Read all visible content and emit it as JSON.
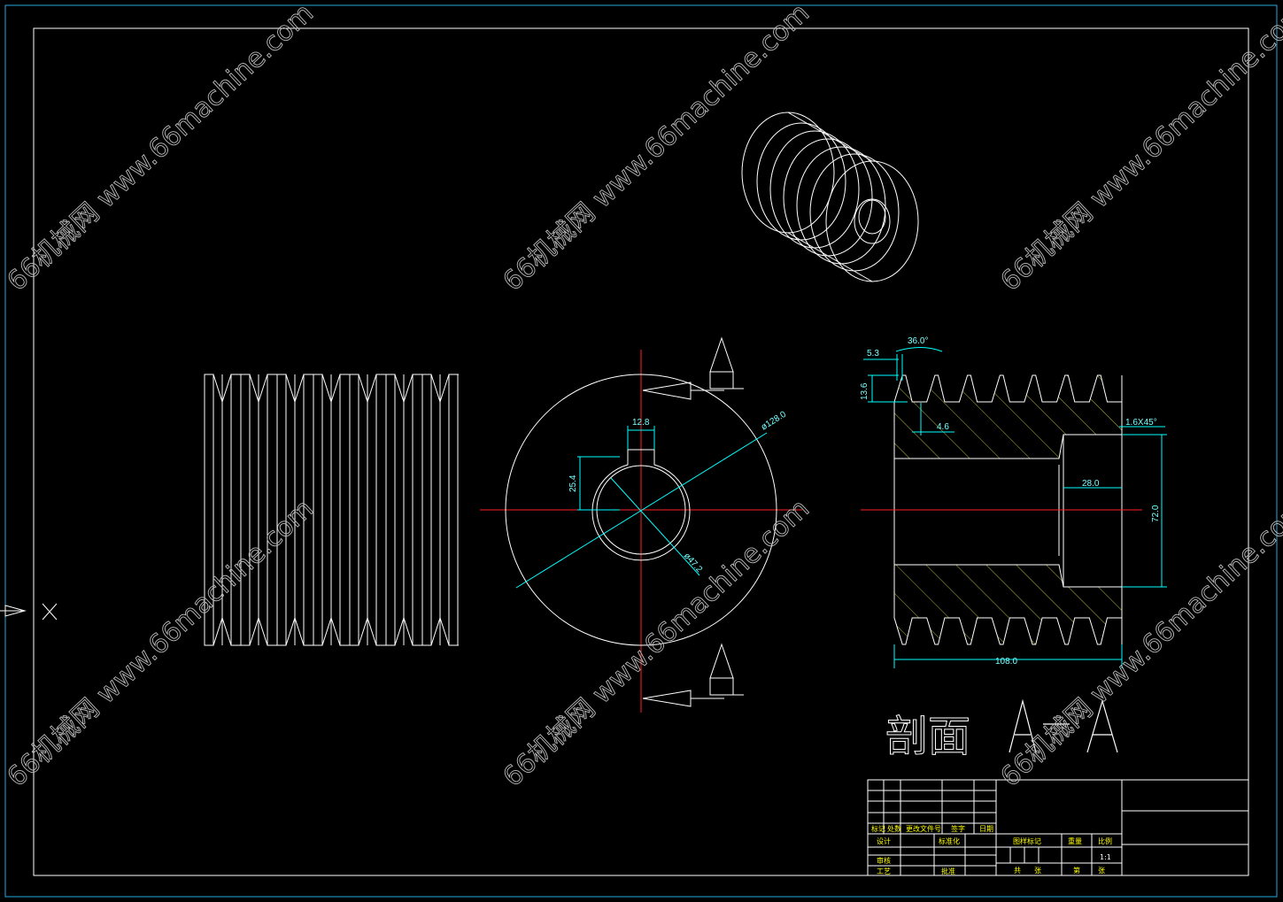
{
  "drawing": {
    "section_title": "剖面 A-A",
    "section_letter_a": "A",
    "section_letter_b": "A"
  },
  "dimensions": {
    "key_width": "12.8",
    "key_depth": "25.4",
    "outer_dia": "ø128.0",
    "bore_dia": "ø47.2",
    "thread_pitch": "5.3",
    "thread_angle": "36.0°",
    "thread_depth": "13.6",
    "root_width": "4.6",
    "chamfer": "1.6X45°",
    "counterbore_depth": "28.0",
    "counterbore_dia": "72.0",
    "overall_length": "108.0"
  },
  "title_block": {
    "row_labels": [
      "标记",
      "处数",
      "更改文件号",
      "签字",
      "日期"
    ],
    "design": "设计",
    "standard": "标准化",
    "review": "审核",
    "process": "工艺",
    "approve": "批准",
    "stage_mark": "图样标记",
    "weight": "重量",
    "scale": "比例",
    "scale_value": "1:1",
    "total_sheets": "共",
    "sheet": "张",
    "sheet_no": "第",
    "sheet_no_end": "张"
  },
  "watermark": {
    "text": "66机械网 www.66machine.com"
  },
  "colors": {
    "outline": "#ffffff",
    "centerline": "#ff2020",
    "dimension": "#00ffff",
    "hatch": "#e8e84a",
    "title_text": "#ffff00"
  }
}
